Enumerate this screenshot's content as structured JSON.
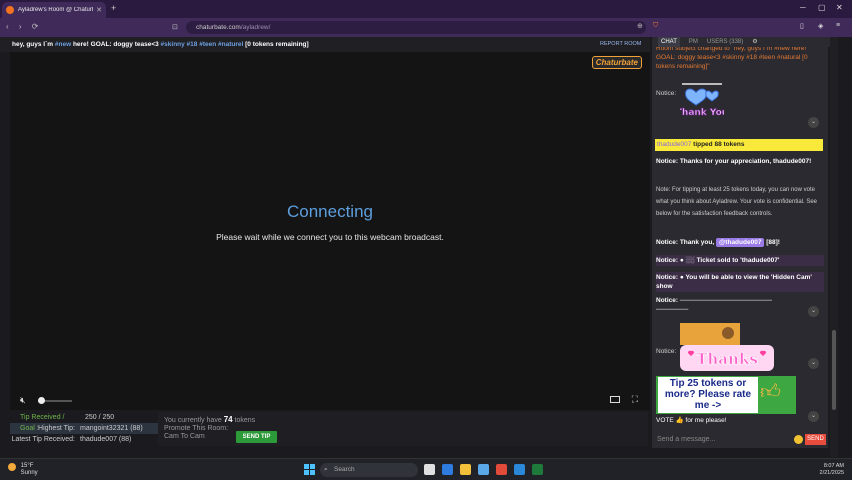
{
  "browser": {
    "tab_title": "Ayladrew's Room @ Chaturbate",
    "url_host": "chaturbate.com",
    "url_path": "/ayladrew/"
  },
  "room": {
    "subject_text": "hey, guys I´m ",
    "subject_tags": [
      "#new"
    ],
    "subject_mid": " here! GOAL: doggy tease<3 ",
    "subject_tags2": "#skinny #18 #teen #naturel",
    "subject_end": " [0 tokens remaining]",
    "report_label": "REPORT ROOM"
  },
  "video": {
    "logo_text": "Chaturbate",
    "status_title": "Connecting",
    "status_message": "Please wait while we connect you to this webcam broadcast."
  },
  "tips": {
    "received_label": "Tip Received / Goal :",
    "received_value": "250 / 250",
    "highest_label": "Highest Tip:",
    "highest_value": "mangoint32321 (88)",
    "latest_label": "Latest Tip Received:",
    "latest_value": "thadude007 (88)"
  },
  "tokens": {
    "have_prefix": "You currently have",
    "count": "74",
    "suffix": "tokens",
    "promote_line1": "Promote This Room:",
    "promote_line2": "Cam To Cam",
    "send_tip_label": "SEND TIP"
  },
  "chat_tabs": {
    "chat": "CHAT",
    "pm": "PM",
    "users": "USERS (338)"
  },
  "chat": {
    "subject_changed": "Room subject changed to \"hey, guys I´m #new here! GOAL: doggy tease<3 #skinny #18 #teen #natural [0 tokens remaining]\"",
    "notice1": "Notice:",
    "tip_user": "thadude007",
    "tip_text": " tipped 88 tokens",
    "thanks_msg": "Notice: Thanks for your appreciation, thadude007!",
    "vote_msg": "Note: For tipping at least 25 tokens today, you can now vote what you think about Ayladrew. Your vote is confidential. See below for the satisfaction feedback controls.",
    "notice_thank_prefix": "Notice: Thank you,",
    "notice_thank_user": "@thadude007",
    "notice_thank_suffix": "[88]!",
    "ticket_msg": "Notice: ● ░░ Ticket sold to 'thadude007'",
    "hidden_cam_msg": "Notice: ● You will be able to view the 'Hidden Cam' show",
    "notice_line": "Notice: ────────────────────",
    "notice_line2": "───────",
    "notice2": "Notice:",
    "thank_img_text": "Thank You",
    "thanks_img_text": "Thanks",
    "rate_text": "Tip 25 tokens or more? Please rate me ->",
    "vote_footer": "VOTE 👍 for me please!",
    "input_placeholder": "Send a message...",
    "send_label": "SEND"
  },
  "taskbar": {
    "temp": "15°F",
    "weather": "Sunny",
    "search_label": "Search",
    "time": "8:07 AM",
    "date": "2/21/2025"
  },
  "colors": {
    "accent_blue": "#5d9ede",
    "tip_green": "#6fb44a",
    "send_tip_green": "#2d9a3a",
    "chat_orange": "#e67a33",
    "tip_highlight": "#f9e93a"
  }
}
